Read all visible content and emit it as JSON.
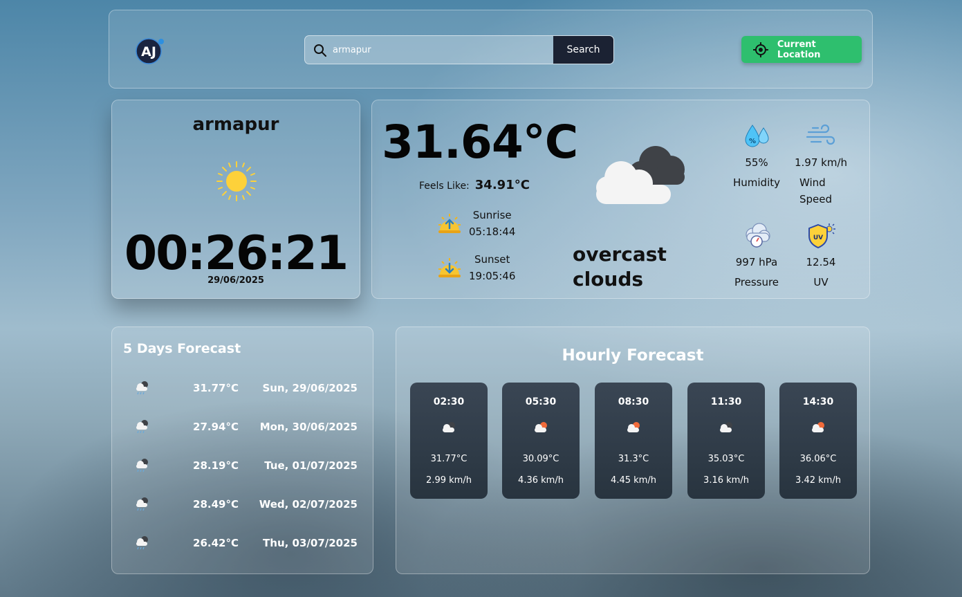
{
  "header": {
    "logo_text": "AJ",
    "search_value": "armapur",
    "search_button": "Search",
    "location_button": "Current Location"
  },
  "city": {
    "name": "armapur",
    "time": "00:26:21",
    "date": "29/06/2025"
  },
  "current": {
    "temperature": "31.64°C",
    "feels_like_label": "Feels Like:",
    "feels_like_value": "34.91°C",
    "sunrise_label": "Sunrise",
    "sunrise_time": "05:18:44",
    "sunset_label": "Sunset",
    "sunset_time": "19:05:46",
    "description_line1": "overcast",
    "description_line2": "clouds",
    "humidity_value": "55%",
    "humidity_label": "Humidity",
    "wind_value": "1.97 km/h",
    "wind_label_1": "Wind",
    "wind_label_2": "Speed",
    "pressure_value": "997 hPa",
    "pressure_label": "Pressure",
    "uv_value": "12.54",
    "uv_label": "UV",
    "uv_badge": "UV"
  },
  "forecast": {
    "title": "5 Days Forecast",
    "days": [
      {
        "temp": "31.77°C",
        "date": "Sun, 29/06/2025",
        "icon": "rain-cloud-icon"
      },
      {
        "temp": "27.94°C",
        "date": "Mon, 30/06/2025",
        "icon": "rain-cloud-icon"
      },
      {
        "temp": "28.19°C",
        "date": "Tue, 01/07/2025",
        "icon": "rain-cloud-icon"
      },
      {
        "temp": "28.49°C",
        "date": "Wed, 02/07/2025",
        "icon": "rain-cloud-icon"
      },
      {
        "temp": "26.42°C",
        "date": "Thu, 03/07/2025",
        "icon": "rain-cloud-icon"
      }
    ]
  },
  "hourly": {
    "title": "Hourly Forecast",
    "hours": [
      {
        "time": "02:30",
        "temp": "31.77°C",
        "wind": "2.99 km/h",
        "icon": "cloud-night-icon"
      },
      {
        "time": "05:30",
        "temp": "30.09°C",
        "wind": "4.36 km/h",
        "icon": "cloud-sun-icon"
      },
      {
        "time": "08:30",
        "temp": "31.3°C",
        "wind": "4.45 km/h",
        "icon": "cloud-sun-icon"
      },
      {
        "time": "11:30",
        "temp": "35.03°C",
        "wind": "3.16 km/h",
        "icon": "cloud-night-icon"
      },
      {
        "time": "14:30",
        "temp": "36.06°C",
        "wind": "3.42 km/h",
        "icon": "cloud-sun-icon"
      }
    ]
  },
  "colors": {
    "accent_green": "#2ebf6e",
    "search_button_bg": "#1b2233",
    "hour_card_bg": "#2f3b48",
    "sun_yellow": "#fdd13a"
  }
}
